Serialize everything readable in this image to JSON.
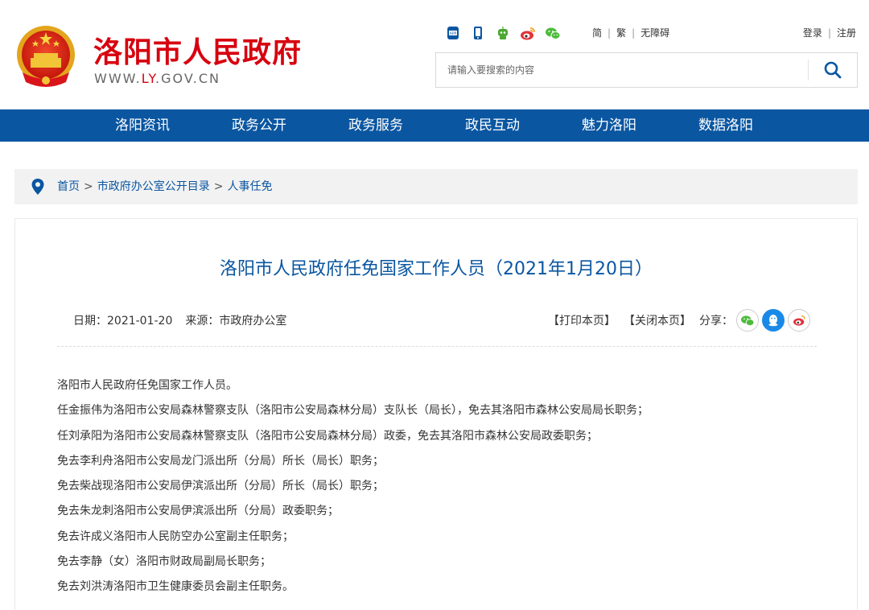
{
  "header": {
    "site_title": "洛阳市人民政府",
    "site_url_prefix": "WWW.",
    "site_url_accent": "LY",
    "site_url_suffix": ".GOV.CN",
    "quick_icons": [
      "app-icon",
      "mobile-icon",
      "robot-icon",
      "weibo-icon",
      "wechat-icon"
    ],
    "lang": {
      "simplified": "简",
      "traditional": "繁",
      "accessibility": "无障碍"
    },
    "user": {
      "login": "登录",
      "register": "注册"
    },
    "search": {
      "placeholder": "请输入要搜索的内容"
    }
  },
  "nav": {
    "items": [
      "洛阳资讯",
      "政务公开",
      "政务服务",
      "政民互动",
      "魅力洛阳",
      "数据洛阳"
    ]
  },
  "breadcrumb": {
    "home": "首页",
    "catalog": "市政府办公室公开目录",
    "current": "人事任免",
    "separator": ">"
  },
  "article": {
    "title": "洛阳市人民政府任免国家工作人员（2021年1月20日）",
    "date_label": "日期：",
    "date": "2021-01-20",
    "source_label": "来源：",
    "source": "市政府办公室",
    "print_label": "【打印本页】",
    "close_label": "【关闭本页】",
    "share_label": "分享：",
    "share_icons": [
      "wechat-icon",
      "qq-icon",
      "weibo-icon"
    ],
    "paragraphs": [
      "洛阳市人民政府任免国家工作人员。",
      "任金振伟为洛阳市公安局森林警察支队（洛阳市公安局森林分局）支队长（局长），免去其洛阳市森林公安局局长职务；",
      "任刘承阳为洛阳市公安局森林警察支队（洛阳市公安局森林分局）政委，免去其洛阳市森林公安局政委职务；",
      "免去李利舟洛阳市公安局龙门派出所（分局）所长（局长）职务；",
      "免去柴战现洛阳市公安局伊滨派出所（分局）所长（局长）职务；",
      "免去朱龙刺洛阳市公安局伊滨派出所（分局）政委职务；",
      "免去许成义洛阳市人民防空办公室副主任职务；",
      "免去李静（女）洛阳市财政局副局长职务；",
      "免去刘洪涛洛阳市卫生健康委员会副主任职务。"
    ]
  },
  "colors": {
    "brand_red": "#d7000f",
    "nav_blue": "#0a56a1",
    "wechat_green": "#4cbb3c",
    "qq_blue": "#1a8ae8",
    "weibo_red": "#e2313a"
  }
}
